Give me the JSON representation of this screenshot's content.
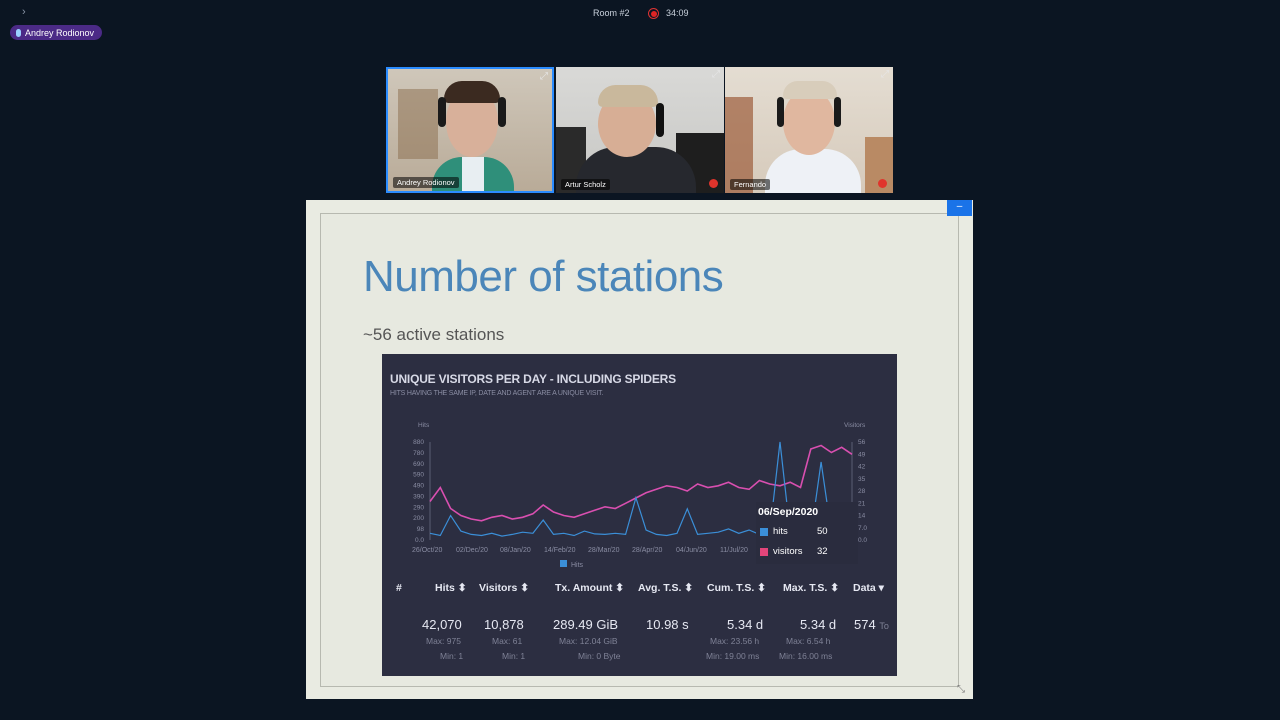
{
  "meeting": {
    "room": "Room #2",
    "timer": "34:09",
    "speaker_badge": "Andrey Rodionov",
    "expand_icon": "chevron-right-icon"
  },
  "participants": [
    {
      "name": "Andrey Rodionov",
      "active": true
    },
    {
      "name": "Artur Scholz",
      "muted": true
    },
    {
      "name": "Fernando",
      "muted": true
    }
  ],
  "slide": {
    "title": "Number of stations",
    "subtitle": "~56 active stations",
    "collapse_label": "–"
  },
  "chart": {
    "title": "UNIQUE VISITORS PER DAY - INCLUDING SPIDERS",
    "subtitle": "HITS HAVING THE SAME IP, DATE AND AGENT ARE A UNIQUE VISIT.",
    "left_axis_label": "Hits",
    "right_axis_label": "Visitors",
    "left_ticks": [
      "880",
      "780",
      "690",
      "590",
      "490",
      "390",
      "290",
      "200",
      "98",
      "0.0"
    ],
    "right_ticks": [
      "56",
      "49",
      "42",
      "35",
      "28",
      "21",
      "14",
      "7.0",
      "0.0"
    ],
    "x_ticks": [
      "26/Oct/20",
      "02/Dec/20",
      "08/Jan/20",
      "14/Feb/20",
      "28/Mar/20",
      "28/Apr/20",
      "04/Jun/20",
      "11/Jul/20"
    ],
    "legend": "Hits",
    "tooltip": {
      "date": "06/Sep/2020",
      "rows": [
        {
          "label": "hits",
          "value": "50",
          "color": "#3b8fd8"
        },
        {
          "label": "visitors",
          "value": "32",
          "color": "#e2457a"
        }
      ]
    },
    "colors": {
      "hits": "#3b8fd8",
      "visitors": "#d94fb0"
    }
  },
  "chart_data": {
    "type": "line",
    "title": "UNIQUE VISITORS PER DAY - INCLUDING SPIDERS",
    "xlabel": "",
    "ylabel": "Hits",
    "y2label": "Visitors",
    "x_range": [
      "26/Oct/20",
      "06/Sep/2020"
    ],
    "ylim": [
      0,
      880
    ],
    "y2lim": [
      0,
      56
    ],
    "series": [
      {
        "name": "hits",
        "values": [
          60,
          40,
          220,
          80,
          50,
          40,
          60,
          35,
          50,
          70,
          60,
          180,
          50,
          60,
          40,
          80,
          55,
          50,
          60,
          50,
          380,
          90,
          50,
          40,
          60,
          280,
          50,
          60,
          70,
          100,
          60,
          90,
          50,
          60,
          900,
          60,
          50,
          40,
          700,
          60,
          50,
          40
        ]
      },
      {
        "name": "visitors",
        "values": [
          22,
          30,
          18,
          14,
          12,
          11,
          13,
          14,
          12,
          13,
          15,
          20,
          16,
          14,
          13,
          15,
          17,
          19,
          18,
          21,
          24,
          27,
          29,
          31,
          30,
          28,
          32,
          30,
          31,
          33,
          30,
          29,
          34,
          32,
          31,
          33,
          30,
          52,
          54,
          50,
          53,
          49
        ]
      }
    ],
    "tooltip": {
      "date": "06/Sep/2020",
      "hits": 50,
      "visitors": 32
    }
  },
  "table": {
    "columns": [
      "#",
      "Hits",
      "Visitors",
      "Tx. Amount",
      "Avg. T.S.",
      "Cum. T.S.",
      "Max. T.S.",
      "Data"
    ],
    "values": [
      "",
      "42,070",
      "10,878",
      "289.49 GiB",
      "10.98 s",
      "5.34 d",
      "5.34 d",
      "574"
    ],
    "suffix_data": "To",
    "max_row": [
      "",
      "Max: 975",
      "Max: 61",
      "Max: 12.04 GiB",
      "",
      "Max: 23.56 h",
      "Max: 6.54 h",
      ""
    ],
    "min_row": [
      "",
      "Min: 1",
      "Min: 1",
      "Min: 0 Byte",
      "",
      "Min: 19.00 ms",
      "Min: 16.00 ms",
      ""
    ]
  }
}
